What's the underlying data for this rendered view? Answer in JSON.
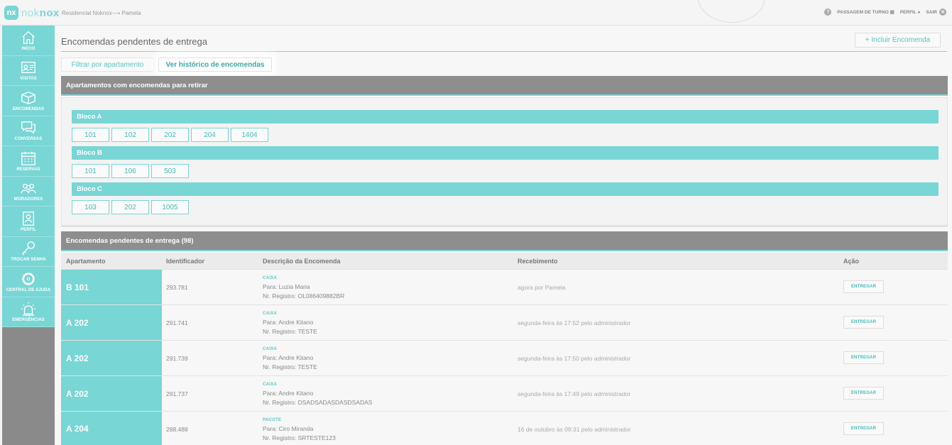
{
  "brand": {
    "logo_badge": "nx",
    "logo_light": "nok",
    "logo_bold": "nox"
  },
  "header": {
    "breadcrumb": "Residencial Noknox⟶ Pamela",
    "help_icon": "?",
    "shift_label": "PASSAGEM DE TURNO",
    "profile_label": "PERFIL",
    "exit_label": "SAIR"
  },
  "sidebar": {
    "items": [
      {
        "label": "INÍCIO",
        "icon": "home-icon"
      },
      {
        "label": "VISITAS",
        "icon": "id-card-icon"
      },
      {
        "label": "ENCOMENDAS",
        "icon": "package-icon"
      },
      {
        "label": "CONVERSAS",
        "icon": "chat-icon"
      },
      {
        "label": "RESERVAS",
        "icon": "calendar-icon"
      },
      {
        "label": "MORADORES",
        "icon": "people-icon"
      },
      {
        "label": "PERFIL",
        "icon": "profile-icon"
      },
      {
        "label": "TROCAR SENHA",
        "icon": "key-icon"
      },
      {
        "label": "CENTRAL DE AJUDA",
        "icon": "lifebuoy-icon"
      },
      {
        "label": "EMERGÊNCIAS",
        "icon": "siren-icon"
      }
    ]
  },
  "main": {
    "title": "Encomendas pendentes de entrega",
    "add_button": "+ Incluir Encomenda",
    "tabs": {
      "filter": "Filtrar por apartamento",
      "history": "Ver histórico de encomendas"
    },
    "apartments_panel": {
      "title": "Apartamentos com encomendas para retirar",
      "blocks": [
        {
          "name": "Bloco A",
          "apartments": [
            "101",
            "102",
            "202",
            "204",
            "1404"
          ]
        },
        {
          "name": "Bloco B",
          "apartments": [
            "101",
            "106",
            "503"
          ]
        },
        {
          "name": "Bloco C",
          "apartments": [
            "103",
            "202",
            "1005"
          ]
        }
      ]
    },
    "pending_panel": {
      "title": "Encomendas pendentes de entrega (98)",
      "columns": {
        "apartment": "Apartamento",
        "identifier": "Identificador",
        "description": "Descrição da Encomenda",
        "received": "Recebimento",
        "action": "Ação"
      },
      "rows": [
        {
          "apt": "B 101",
          "id": "293.781",
          "type": "CAIXA",
          "to": "Para: Luzia Maria",
          "reg": "Nr. Registro: OL086409882BR",
          "received": "agora por Pamela",
          "action": "ENTREGAR"
        },
        {
          "apt": "A 202",
          "id": "291.741",
          "type": "CAIXA",
          "to": "Para: Andre Kitano",
          "reg": "Nr. Registro: TESTE",
          "received": "segunda-feira às 17:52 pelo administrador",
          "action": "ENTREGAR"
        },
        {
          "apt": "A 202",
          "id": "291.739",
          "type": "CAIXA",
          "to": "Para: Andre Kitano",
          "reg": "Nr. Registro: TESTE",
          "received": "segunda-feira às 17:50 pelo administrador",
          "action": "ENTREGAR"
        },
        {
          "apt": "A 202",
          "id": "291.737",
          "type": "CAIXA",
          "to": "Para: Andre Kitano",
          "reg": "Nr. Registro: DSADSADASDASDSADAS",
          "received": "segunda-feira às 17:49 pelo administrador",
          "action": "ENTREGAR"
        },
        {
          "apt": "A 204",
          "id": "288.488",
          "type": "PACOTE",
          "to": "Para: Ciro Miranda",
          "reg": "Nr. Registro: SRTESTE123",
          "received": "16 de outubro às 09:31 pelo administrador",
          "action": "ENTREGAR"
        }
      ]
    }
  },
  "colors": {
    "accent": "#78d6d5",
    "panel_header": "#8e8e8e",
    "sidebar_bottom": "#8a8a8a"
  }
}
